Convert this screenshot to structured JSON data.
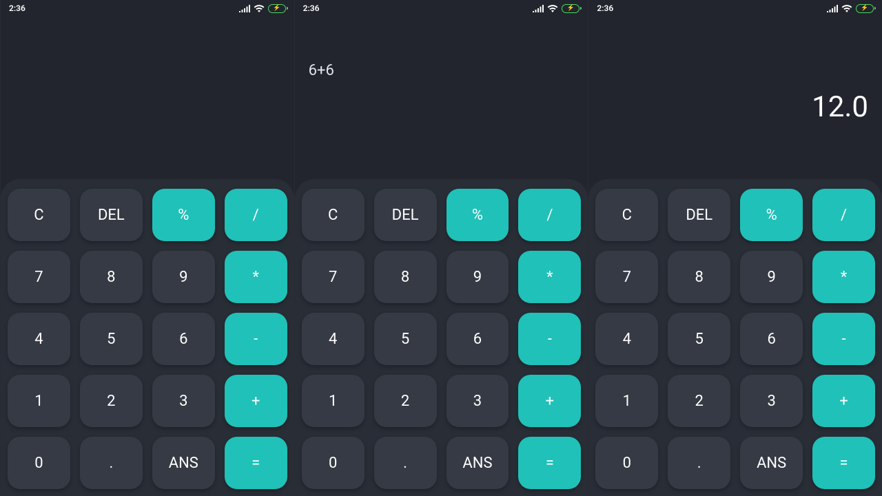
{
  "status": {
    "time": "2:36"
  },
  "screens": [
    {
      "expression": "",
      "result": ""
    },
    {
      "expression": "6+6",
      "result": ""
    },
    {
      "expression": "",
      "result": "12.0"
    }
  ],
  "keys": [
    {
      "label": "C",
      "name": "clear-button",
      "accent": false
    },
    {
      "label": "DEL",
      "name": "delete-button",
      "accent": false
    },
    {
      "label": "%",
      "name": "percent-button",
      "accent": true
    },
    {
      "label": "/",
      "name": "divide-button",
      "accent": true
    },
    {
      "label": "7",
      "name": "digit-7-button",
      "accent": false
    },
    {
      "label": "8",
      "name": "digit-8-button",
      "accent": false
    },
    {
      "label": "9",
      "name": "digit-9-button",
      "accent": false
    },
    {
      "label": "*",
      "name": "multiply-button",
      "accent": true
    },
    {
      "label": "4",
      "name": "digit-4-button",
      "accent": false
    },
    {
      "label": "5",
      "name": "digit-5-button",
      "accent": false
    },
    {
      "label": "6",
      "name": "digit-6-button",
      "accent": false
    },
    {
      "label": "-",
      "name": "minus-button",
      "accent": true
    },
    {
      "label": "1",
      "name": "digit-1-button",
      "accent": false
    },
    {
      "label": "2",
      "name": "digit-2-button",
      "accent": false
    },
    {
      "label": "3",
      "name": "digit-3-button",
      "accent": false
    },
    {
      "label": "+",
      "name": "plus-button",
      "accent": true
    },
    {
      "label": "0",
      "name": "digit-0-button",
      "accent": false
    },
    {
      "label": ".",
      "name": "decimal-button",
      "accent": false
    },
    {
      "label": "ANS",
      "name": "ans-button",
      "accent": false
    },
    {
      "label": "=",
      "name": "equals-button",
      "accent": true
    }
  ],
  "colors": {
    "bg": "#22252d",
    "keypad_bg": "#292d36",
    "key_bg": "#363a44",
    "accent": "#20c1b8",
    "battery": "#4cd964"
  }
}
